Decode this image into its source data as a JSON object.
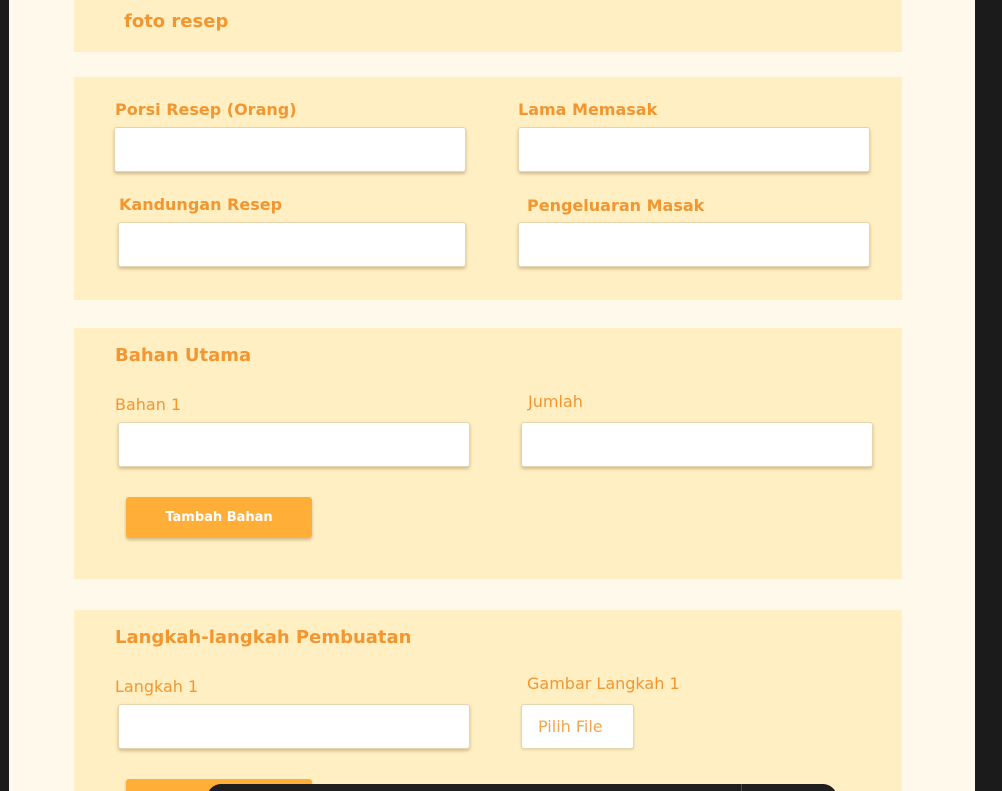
{
  "photo_section": {
    "title": "foto resep"
  },
  "info_section": {
    "porsi_label": "Porsi Resep (Orang)",
    "lama_label": "Lama Memasak",
    "kandungan_label": "Kandungan Resep",
    "pengeluaran_label": "Pengeluaran Masak"
  },
  "bahan_section": {
    "title": "Bahan Utama",
    "bahan_label": "Bahan 1",
    "jumlah_label": "Jumlah",
    "add_button_label": "Tambah Bahan"
  },
  "langkah_section": {
    "title": "Langkah-langkah Pembuatan",
    "langkah_label": "Langkah 1",
    "gambar_label": "Gambar Langkah 1",
    "file_button_label": "Pilih File"
  },
  "colors": {
    "accent": "#f4962f",
    "button": "#ffae38",
    "card": "#ffefc2",
    "background": "#fff9ec"
  }
}
